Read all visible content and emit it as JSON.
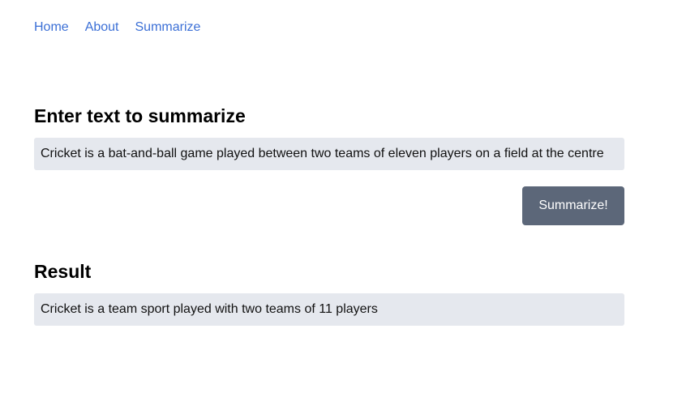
{
  "nav": {
    "items": [
      {
        "label": "Home"
      },
      {
        "label": "About"
      },
      {
        "label": "Summarize"
      }
    ]
  },
  "input_section": {
    "title": "Enter text to summarize",
    "value": "Cricket is a bat-and-ball game played between two teams of eleven players on a field at the centre"
  },
  "submit_button": {
    "label": "Summarize!"
  },
  "result_section": {
    "title": "Result",
    "value": "Cricket is a team sport played with two teams of 11 players"
  },
  "colors": {
    "link": "#3b6fd6",
    "field_bg": "#e5e8ee",
    "button_bg": "#5c6779",
    "button_text": "#ffffff"
  }
}
